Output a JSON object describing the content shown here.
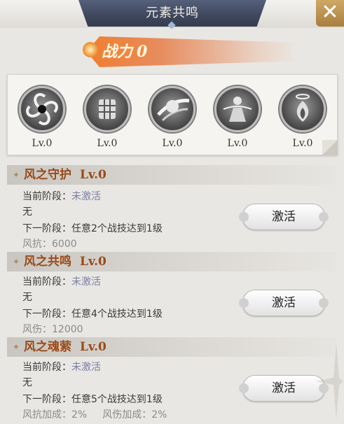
{
  "window": {
    "title": "元素共鸣",
    "close_icon": "close-icon"
  },
  "power": {
    "label": "战力",
    "value": "0"
  },
  "elements": [
    {
      "icon": "wind-vortex-icon",
      "level": "Lv.0"
    },
    {
      "icon": "cube-orb-icon",
      "level": "Lv.0"
    },
    {
      "icon": "slash-orb-icon",
      "level": "Lv.0"
    },
    {
      "icon": "figure-orb-icon",
      "level": "Lv.0"
    },
    {
      "icon": "soul-flame-icon",
      "level": "Lv.0"
    }
  ],
  "sections": [
    {
      "name": "风之守护",
      "level": "Lv.0",
      "current_label": "当前阶段：",
      "current_value": "未激活",
      "current_effect": "无",
      "next_label": "下一阶段：",
      "next_value": "任意2个战技达到1级",
      "bonus": "风抗：6000",
      "button": "激活"
    },
    {
      "name": "风之共鸣",
      "level": "Lv.0",
      "current_label": "当前阶段：",
      "current_value": "未激活",
      "current_effect": "无",
      "next_label": "下一阶段：",
      "next_value": "任意4个战技达到1级",
      "bonus": "风伤：12000",
      "button": "激活"
    },
    {
      "name": "风之魂萦",
      "level": "Lv.0",
      "current_label": "当前阶段：",
      "current_value": "未激活",
      "current_effect": "无",
      "next_label": "下一阶段：",
      "next_value": "任意5个战技达到1级",
      "bonus": "风抗加成：2%",
      "bonus2": "风伤加成：2%",
      "button": "激活"
    }
  ]
}
